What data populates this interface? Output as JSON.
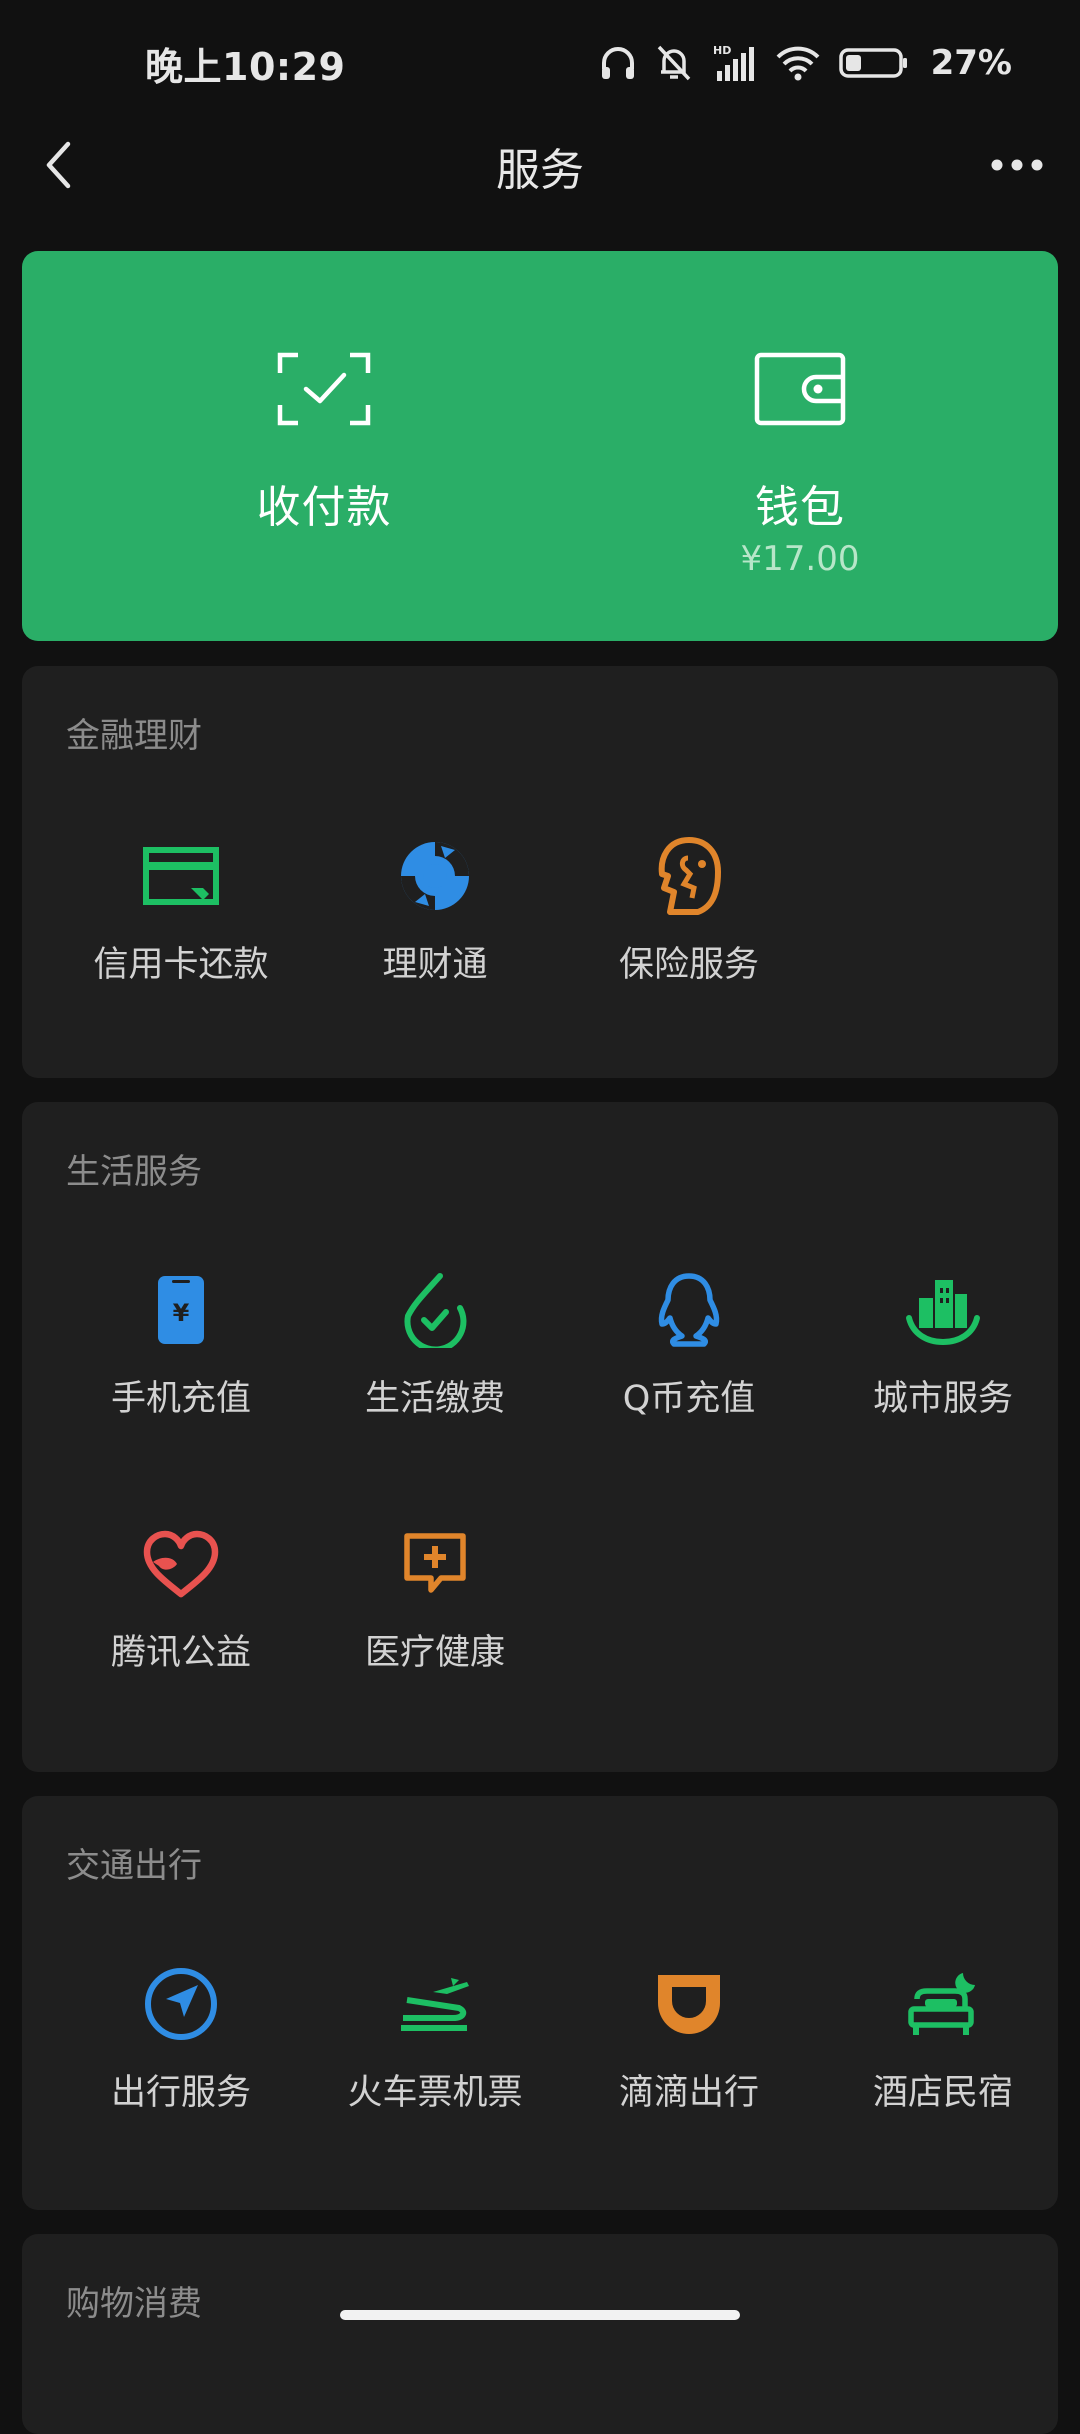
{
  "status": {
    "time": "晚上10:29",
    "battery": "27%",
    "network_badge": "HD"
  },
  "nav": {
    "title": "服务"
  },
  "hero": {
    "pay_label": "收付款",
    "wallet_label": "钱包",
    "wallet_balance": "¥17.00",
    "bg_color": "#2aae67"
  },
  "finance": {
    "title": "金融理财",
    "items": [
      {
        "label": "信用卡还款",
        "icon": "credit-card-icon"
      },
      {
        "label": "理财通",
        "icon": "wealth-icon"
      },
      {
        "label": "保险服务",
        "icon": "insurance-icon"
      }
    ]
  },
  "life": {
    "title": "生活服务",
    "items": [
      {
        "label": "手机充值",
        "icon": "phone-recharge-icon"
      },
      {
        "label": "生活缴费",
        "icon": "utility-payment-icon"
      },
      {
        "label": "Q币充值",
        "icon": "qq-coin-icon"
      },
      {
        "label": "城市服务",
        "icon": "city-service-icon"
      },
      {
        "label": "腾讯公益",
        "icon": "charity-heart-icon"
      },
      {
        "label": "医疗健康",
        "icon": "medical-icon"
      }
    ]
  },
  "transport": {
    "title": "交通出行",
    "items": [
      {
        "label": "出行服务",
        "icon": "navigation-icon"
      },
      {
        "label": "火车票机票",
        "icon": "train-plane-icon"
      },
      {
        "label": "滴滴出行",
        "icon": "didi-icon"
      },
      {
        "label": "酒店民宿",
        "icon": "hotel-bed-icon"
      }
    ]
  },
  "shopping": {
    "title": "购物消费"
  }
}
